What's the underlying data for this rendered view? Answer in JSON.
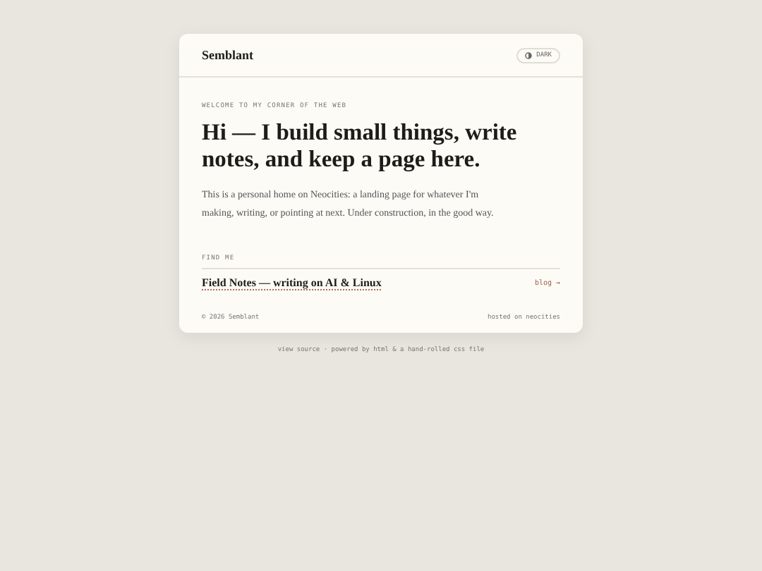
{
  "header": {
    "site_title": "Semblant",
    "theme_button": "DARK"
  },
  "intro": {
    "eyebrow": "WELCOME TO MY CORNER OF THE WEB",
    "heading": "Hi — I build small things, write notes, and keep a page here.",
    "body": "This is a personal home on Neocities: a landing page for whatever I'm making, writing, or pointing at next. Under construction, in the good way."
  },
  "find_me": {
    "label": "FIND ME",
    "links": [
      {
        "title": "Field Notes — writing on AI & Linux",
        "tag": "blog →"
      }
    ]
  },
  "card_footer": {
    "copyright": "© 2026 Semblant",
    "host": "hosted on neocities"
  },
  "page_footer": "view source · powered by html & a hand-rolled css file"
}
